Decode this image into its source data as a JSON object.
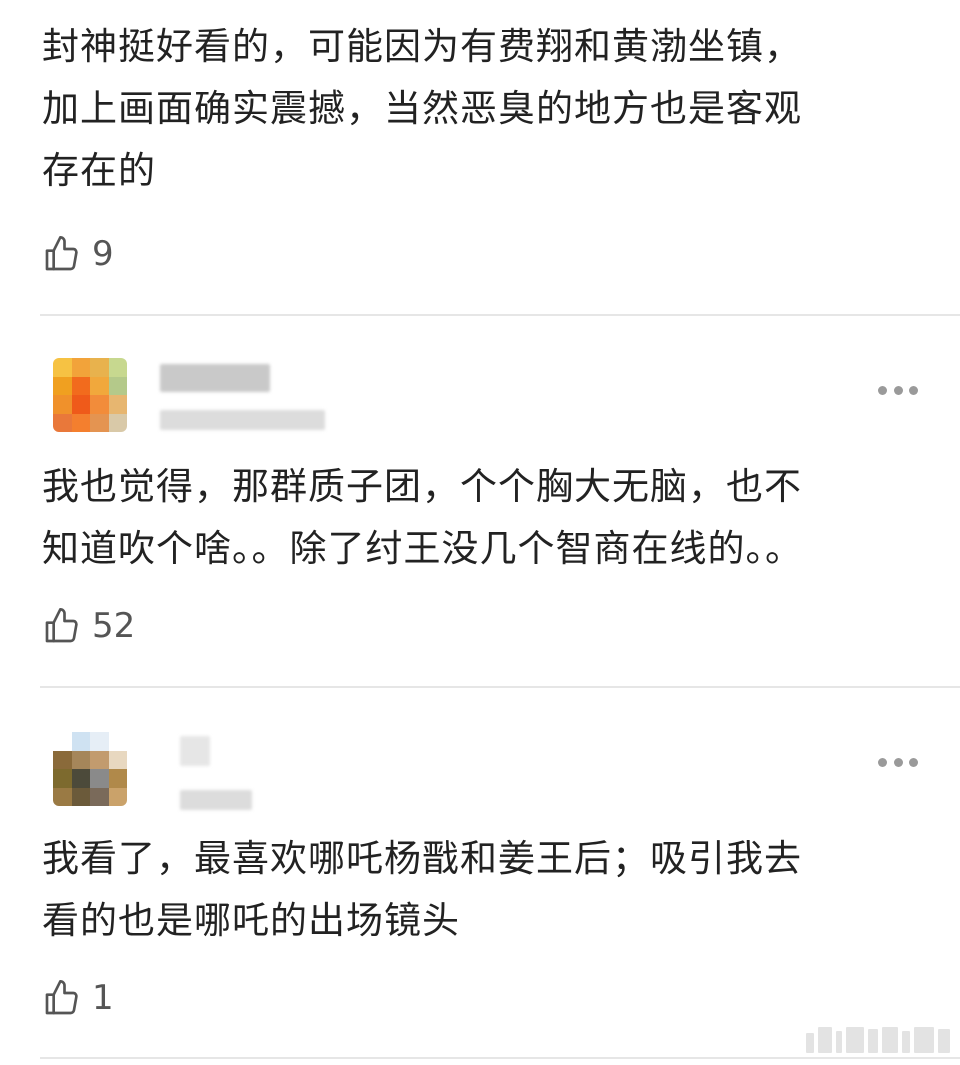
{
  "comments": [
    {
      "lines": [
        "封神挺好看的，可能因为有费翔和黄渤坐镇，",
        "加上画面确实震撼，当然恶臭的地方也是客观",
        "存在的"
      ],
      "likes": "9"
    },
    {
      "lines": [
        "我也觉得，那群质子团，个个胸大无脑，也不",
        "知道吹个啥。。除了纣王没几个智商在线的。。"
      ],
      "likes": "52"
    },
    {
      "lines": [
        "我看了，最喜欢哪吒杨戬和姜王后；吸引我去",
        "看的也是哪吒的出场镜头"
      ],
      "likes": "1"
    }
  ],
  "icons": {
    "like": "thumbs-up-icon",
    "more": "more-horizontal-icon"
  },
  "colors": {
    "text": "#222222",
    "meta": "#555555",
    "divider": "#e6e6e6",
    "dots": "#9a9a9a"
  }
}
